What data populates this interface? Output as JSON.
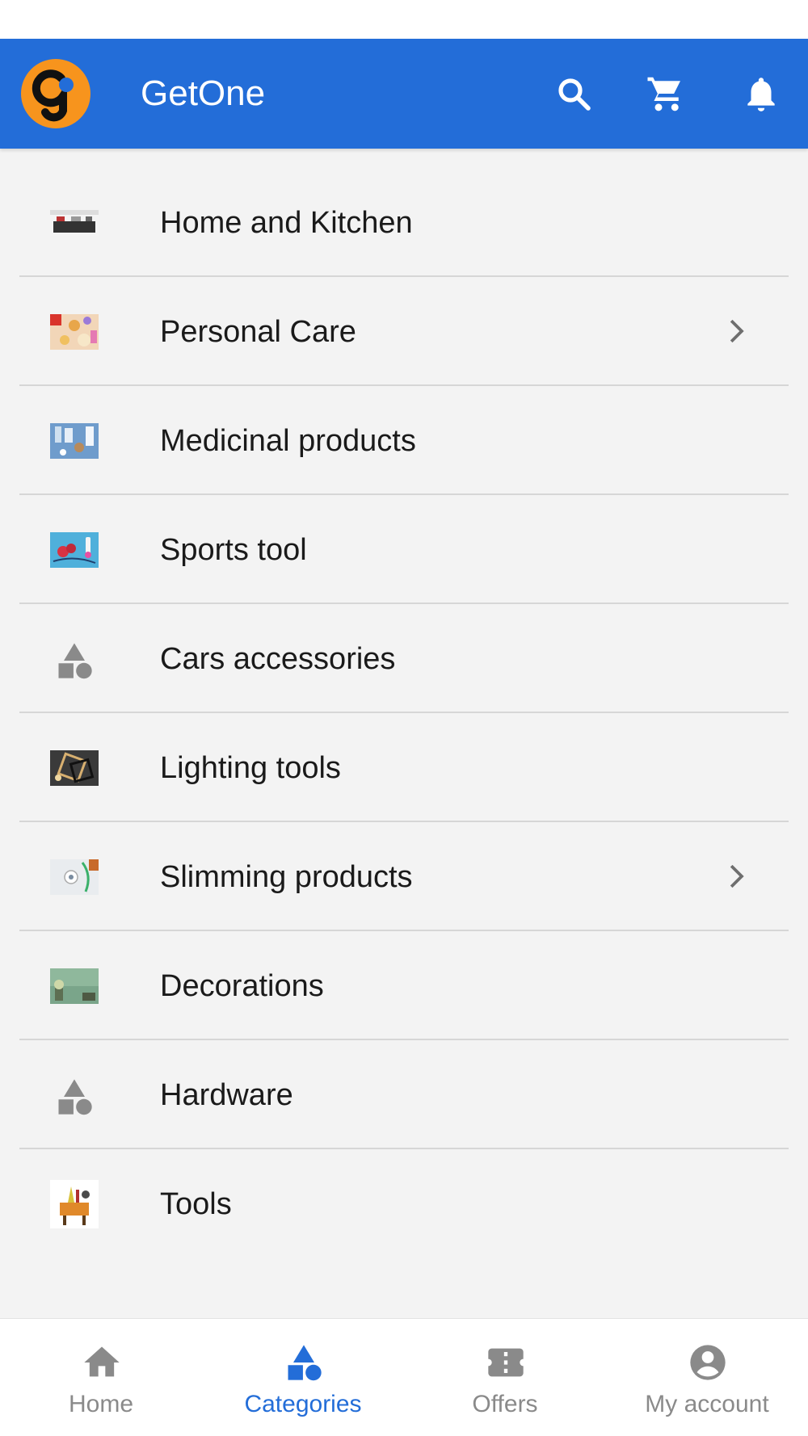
{
  "app": {
    "title": "GetOne",
    "logo_text": "Get One",
    "accent": "#236dd8",
    "logo_color": "#f7941d"
  },
  "app_bar": {
    "actions": [
      {
        "name": "search",
        "icon": "search-icon"
      },
      {
        "name": "cart",
        "icon": "cart-icon"
      },
      {
        "name": "notifications",
        "icon": "bell-icon"
      }
    ]
  },
  "categories": [
    {
      "label": "Home and Kitchen",
      "icon": "photo-thumbnail",
      "has_children": false
    },
    {
      "label": "Personal Care",
      "icon": "photo-thumbnail",
      "has_children": true
    },
    {
      "label": "Medicinal products",
      "icon": "photo-thumbnail",
      "has_children": false
    },
    {
      "label": "Sports tool",
      "icon": "photo-thumbnail",
      "has_children": false
    },
    {
      "label": "Cars accessories",
      "icon": "category-shapes-icon",
      "has_children": false
    },
    {
      "label": "Lighting tools",
      "icon": "photo-thumbnail",
      "has_children": false
    },
    {
      "label": "Slimming products",
      "icon": "photo-thumbnail",
      "has_children": true
    },
    {
      "label": "Decorations",
      "icon": "photo-thumbnail",
      "has_children": false
    },
    {
      "label": "Hardware",
      "icon": "category-shapes-icon",
      "has_children": false
    },
    {
      "label": "Tools",
      "icon": "photo-thumbnail",
      "has_children": false
    }
  ],
  "bottom_nav": {
    "items": [
      {
        "label": "Home",
        "icon": "home-icon",
        "active": false
      },
      {
        "label": "Categories",
        "icon": "categories-icon",
        "active": true
      },
      {
        "label": "Offers",
        "icon": "ticket-icon",
        "active": false
      },
      {
        "label": "My account",
        "icon": "account-icon",
        "active": false
      }
    ],
    "active_color": "#236dd8",
    "inactive_color": "#8a8a8a"
  }
}
